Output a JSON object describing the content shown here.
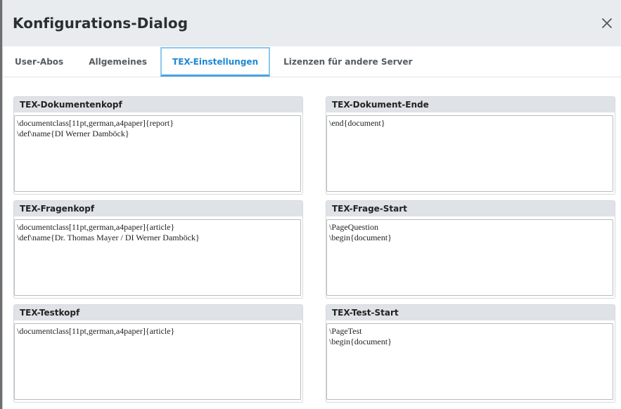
{
  "dialog": {
    "title": "Konfigurations-Dialog",
    "close_icon": "close-icon"
  },
  "tabs": [
    {
      "label": "User-Abos",
      "active": false
    },
    {
      "label": "Allgemeines",
      "active": false
    },
    {
      "label": "TEX-Einstellungen",
      "active": true
    },
    {
      "label": "Lizenzen für andere Server",
      "active": false
    }
  ],
  "panels": {
    "doc_head": {
      "label": "TEX-Dokumentenkopf",
      "value": "\\documentclass[11pt,german,a4paper]{report}\n\\def\\name{DI Werner Damböck}"
    },
    "doc_end": {
      "label": "TEX-Dokument-Ende",
      "value": "\\end{document}"
    },
    "question_head": {
      "label": "TEX-Fragenkopf",
      "value": "\\documentclass[11pt,german,a4paper]{article}\n\\def\\name{Dr. Thomas Mayer / DI Werner Damböck}"
    },
    "question_start": {
      "label": "TEX-Frage-Start",
      "value": "\\PageQuestion\n\\begin{document}"
    },
    "test_head": {
      "label": "TEX-Testkopf",
      "value": "\\documentclass[11pt,german,a4paper]{article}"
    },
    "test_start": {
      "label": "TEX-Test-Start",
      "value": "\\PageTest\n\\begin{document}"
    }
  },
  "colors": {
    "active_tab": "#1e88d2",
    "header_bg": "#e9ecef",
    "panel_head_bg": "#dfe2e6"
  }
}
